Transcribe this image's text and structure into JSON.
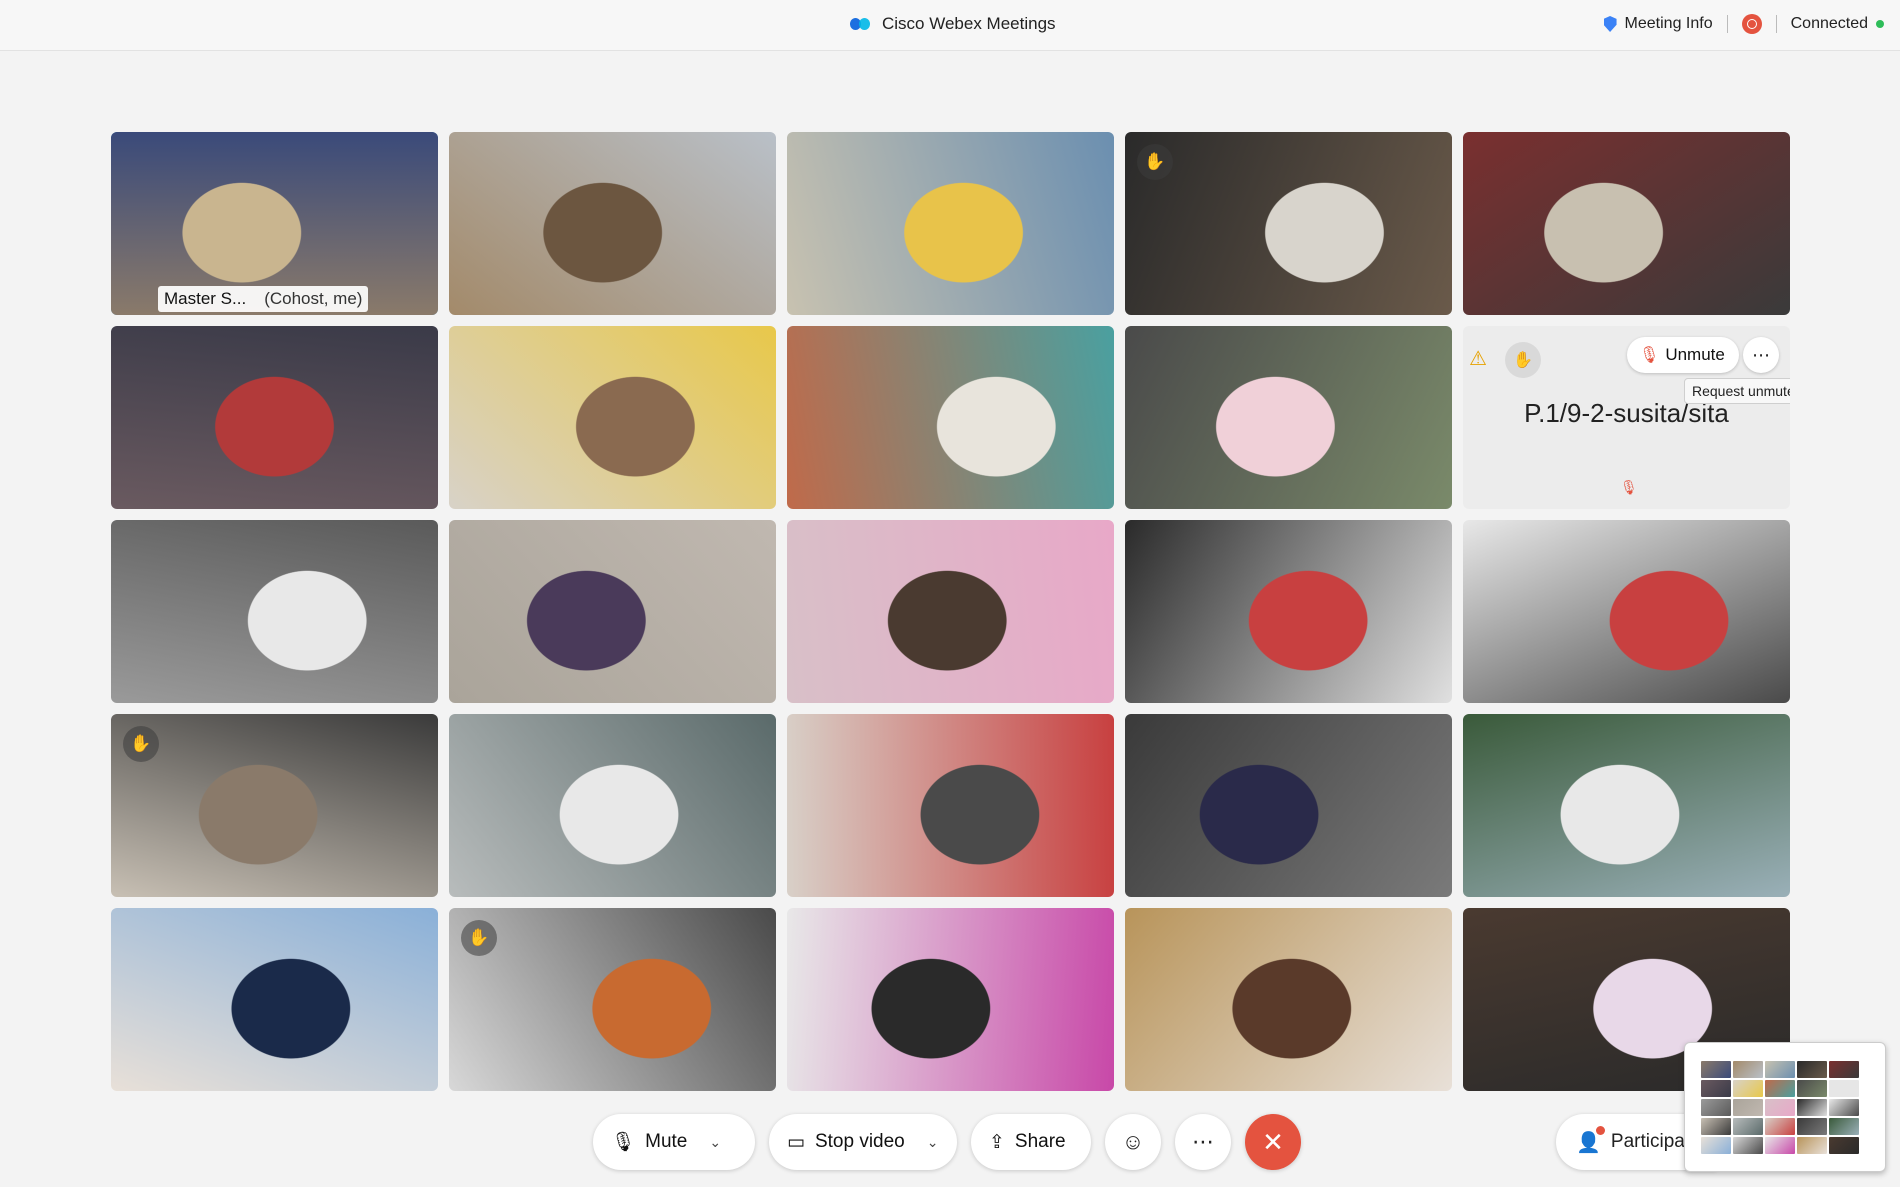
{
  "window": {
    "title": "Cisco Webex Meetings",
    "meeting_info": "Meeting Info",
    "status": "Connected"
  },
  "tiles": [
    {
      "kind": "video",
      "active": true,
      "name": "Master S...",
      "role": "(Cohost, me)"
    },
    {
      "kind": "video"
    },
    {
      "kind": "video"
    },
    {
      "kind": "video",
      "hand": true
    },
    {
      "kind": "video"
    },
    {
      "kind": "video"
    },
    {
      "kind": "video"
    },
    {
      "kind": "video"
    },
    {
      "kind": "video"
    },
    {
      "kind": "audio",
      "name": "P.1/9-2-susita/sita",
      "unmute_label": "Unmute",
      "tooltip": "Request unmute"
    },
    {
      "kind": "video"
    },
    {
      "kind": "video"
    },
    {
      "kind": "video"
    },
    {
      "kind": "video"
    },
    {
      "kind": "video"
    },
    {
      "kind": "video",
      "hand": true
    },
    {
      "kind": "video"
    },
    {
      "kind": "video"
    },
    {
      "kind": "video"
    },
    {
      "kind": "video"
    },
    {
      "kind": "video"
    },
    {
      "kind": "video",
      "hand": true
    },
    {
      "kind": "video"
    },
    {
      "kind": "video"
    },
    {
      "kind": "video"
    }
  ],
  "toolbar": {
    "mute_label": "Mute",
    "stop_video_label": "Stop video",
    "share_label": "Share",
    "participants_label": "Participa"
  },
  "colors": {
    "accent_active": "#4fb2ea",
    "end_call": "#e4533f",
    "recording": "#e4533f",
    "connected": "#2ebd59"
  }
}
